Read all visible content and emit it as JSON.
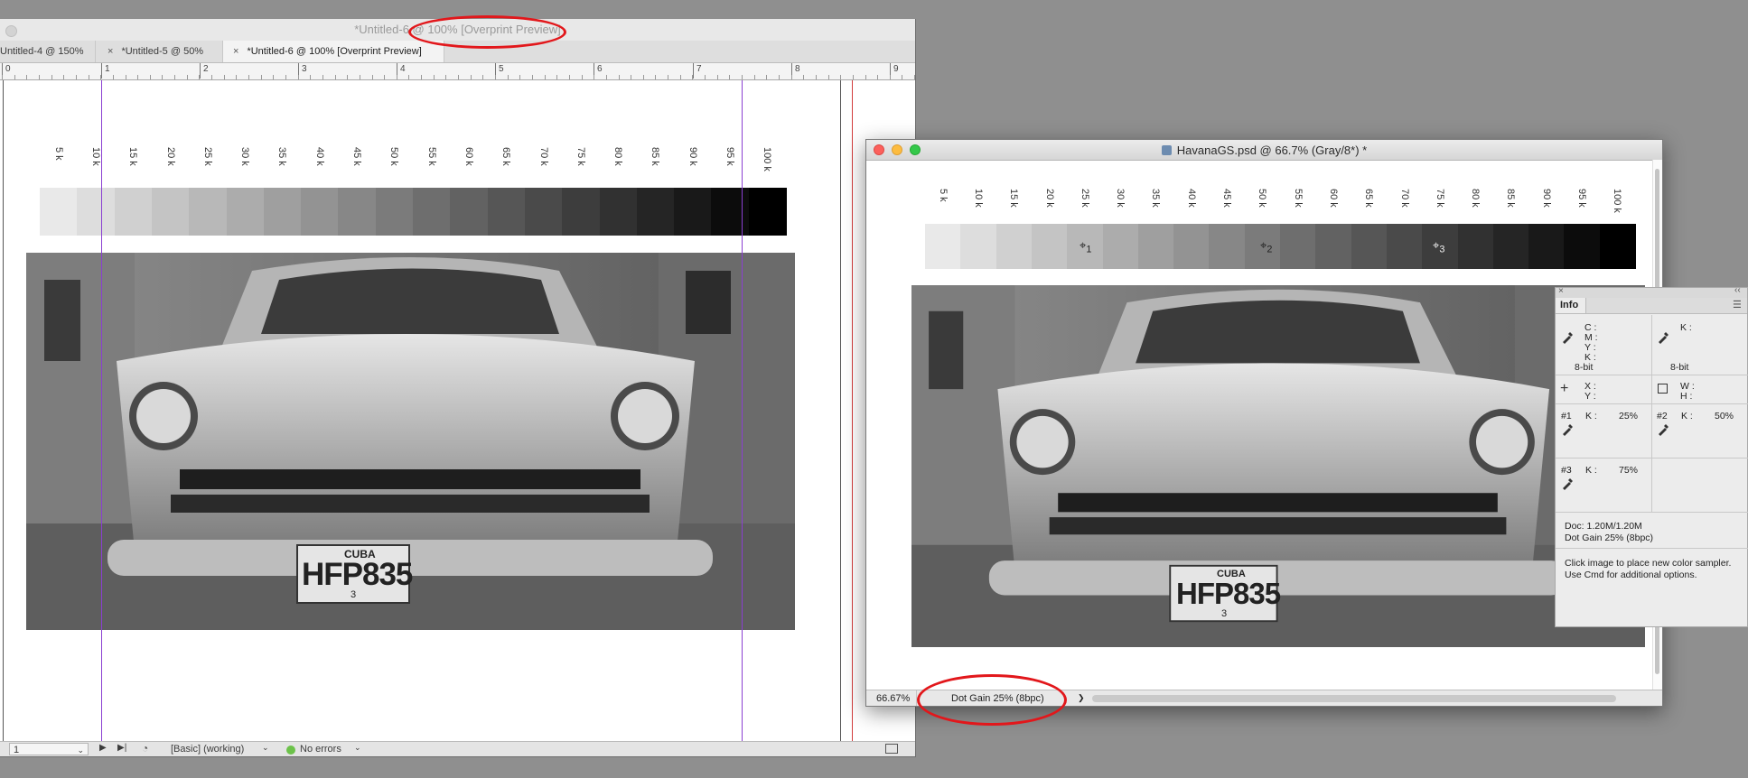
{
  "indesign": {
    "window_title": "*Untitled-6 @ 100% [Overprint Preview]",
    "tabs": [
      {
        "label": "Untitled-4 @ 150%"
      },
      {
        "label": "*Untitled-5 @ 50%"
      },
      {
        "label": "*Untitled-6 @ 100% [Overprint Preview]"
      }
    ],
    "tab_close_symbol": "×",
    "ruler_numbers": [
      "0",
      "1",
      "2",
      "3",
      "4",
      "5",
      "6",
      "7",
      "8",
      "9"
    ],
    "status": {
      "page": "1",
      "preflight_profile": "[Basic] (working)",
      "preflight_status": "No errors"
    }
  },
  "tone_strip_labels": [
    "5 k",
    "10 k",
    "15 k",
    "20 k",
    "25 k",
    "30 k",
    "35 k",
    "40 k",
    "45 k",
    "50 k",
    "55 k",
    "60 k",
    "65 k",
    "70 k",
    "75 k",
    "80 k",
    "85 k",
    "90 k",
    "95 k",
    "100 k"
  ],
  "license_plate": {
    "country": "CUBA",
    "number": "HFP835",
    "small": "3"
  },
  "photoshop": {
    "window_title": "HavanaGS.psd @ 66.7% (Gray/8*) *",
    "zoom": "66.67%",
    "status_profile": "Dot Gain 25% (8bpc)",
    "status_arrow": "❯",
    "sampler_labels": [
      "1",
      "2",
      "3"
    ]
  },
  "info_panel": {
    "title": "Info",
    "cmyk_labels": [
      "C :",
      "M :",
      "Y :",
      "K :"
    ],
    "k_label": "K :",
    "bit_depth_left": "8-bit",
    "bit_depth_right": "8-bit",
    "xy_labels": [
      "X :",
      "Y :"
    ],
    "wh_labels": [
      "W :",
      "H :"
    ],
    "samplers": [
      {
        "id": "#1",
        "channel": "K :",
        "value": "25%"
      },
      {
        "id": "#2",
        "channel": "K :",
        "value": "50%"
      },
      {
        "id": "#3",
        "channel": "K :",
        "value": "75%"
      }
    ],
    "doc_size": "Doc: 1.20M/1.20M",
    "profile": "Dot Gain 25% (8bpc)",
    "hint_line1": "Click image to place new color sampler.",
    "hint_line2": "Use Cmd for additional options."
  },
  "colors": {
    "annotation_red": "#e2171b",
    "guide_purple": "#8a3fd1",
    "guide_red": "#d23c3c",
    "preflight_ok_green": "#6cc24a"
  }
}
